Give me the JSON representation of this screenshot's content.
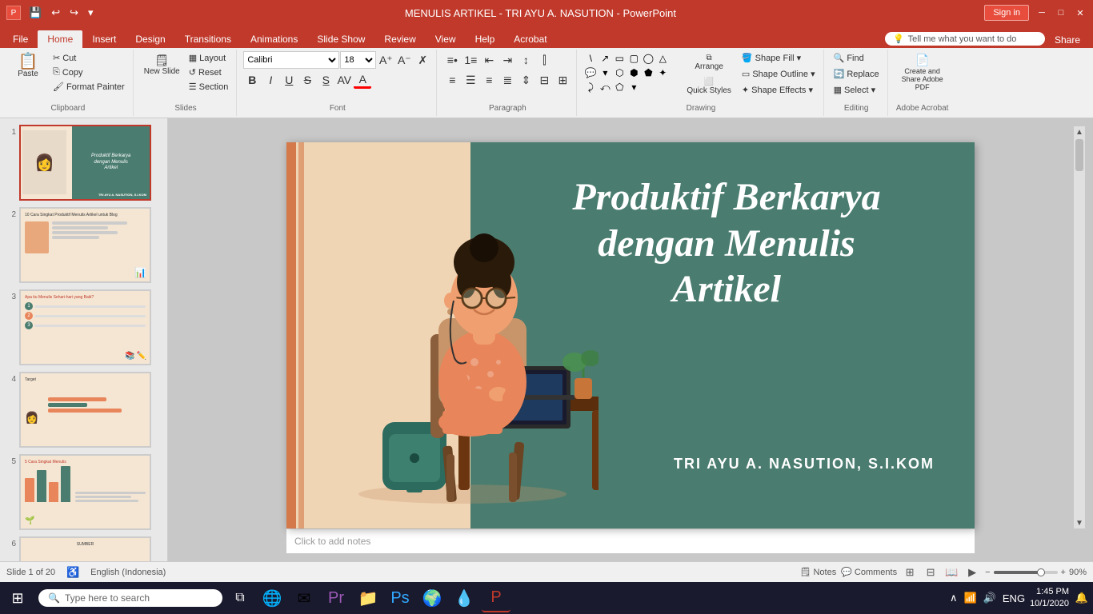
{
  "titlebar": {
    "title": "MENULIS ARTIKEL - TRI AYU A. NASUTION - PowerPoint",
    "sign_in": "Sign in"
  },
  "quickaccess": {
    "save": "💾",
    "undo": "↩",
    "redo": "↪",
    "customize": "▾"
  },
  "tabs": [
    {
      "label": "File",
      "active": false
    },
    {
      "label": "Home",
      "active": true
    },
    {
      "label": "Insert",
      "active": false
    },
    {
      "label": "Design",
      "active": false
    },
    {
      "label": "Transitions",
      "active": false
    },
    {
      "label": "Animations",
      "active": false
    },
    {
      "label": "Slide Show",
      "active": false
    },
    {
      "label": "Review",
      "active": false
    },
    {
      "label": "View",
      "active": false
    },
    {
      "label": "Help",
      "active": false
    },
    {
      "label": "Acrobat",
      "active": false
    }
  ],
  "tell_me": "Tell me what you want to do",
  "share": "Share",
  "ribbon": {
    "clipboard": {
      "label": "Clipboard",
      "paste": "Paste",
      "cut": "Cut",
      "copy": "Copy",
      "format_painter": "Format Painter"
    },
    "slides": {
      "label": "Slides",
      "new_slide": "New Slide",
      "layout": "Layout",
      "reset": "Reset",
      "section": "Section"
    },
    "font": {
      "label": "Font",
      "font_family": "Calibri",
      "font_size": "18",
      "bold": "B",
      "italic": "I",
      "underline": "U",
      "strikethrough": "S",
      "shadow": "S",
      "char_spacing": "A",
      "font_color": "A",
      "increase_font": "A↑",
      "decrease_font": "A↓",
      "clear_formatting": "✗A"
    },
    "paragraph": {
      "label": "Paragraph",
      "bullets": "≡",
      "numbering": "1≡",
      "decrease_indent": "←≡",
      "increase_indent": "→≡",
      "line_spacing": "↕≡",
      "align_left": "≡",
      "align_center": "≡",
      "align_right": "≡",
      "justify": "≡",
      "columns": "⫿"
    },
    "drawing": {
      "label": "Drawing",
      "arrange": "Arrange",
      "quick_styles": "Quick Styles",
      "shape_fill": "Shape Fill ▾",
      "shape_outline": "Shape Outline ▾",
      "shape_effects": "Shape Effects ▾"
    },
    "editing": {
      "label": "Editing",
      "find": "Find",
      "replace": "Replace",
      "select": "Select ▾"
    },
    "acrobat": {
      "label": "Adobe Acrobat",
      "create_share": "Create and Share Adobe PDF"
    }
  },
  "slides": [
    {
      "num": "1",
      "active": true
    },
    {
      "num": "2",
      "active": false
    },
    {
      "num": "3",
      "active": false
    },
    {
      "num": "4",
      "active": false
    },
    {
      "num": "5",
      "active": false
    },
    {
      "num": "6",
      "active": false
    }
  ],
  "main_slide": {
    "title_line1": "Produktif Berkarya",
    "title_line2": "dengan Menulis",
    "title_line3": "Artikel",
    "subtitle": "TRI AYU A. NASUTION, S.I.KOM",
    "notes_placeholder": "Click to add notes"
  },
  "statusbar": {
    "slide_info": "Slide 1 of 20",
    "language": "English (Indonesia)",
    "notes": "Notes",
    "comments": "Comments",
    "zoom": "90%"
  },
  "taskbar": {
    "search_placeholder": "Type here to search",
    "time": "1:45 PM",
    "date": "10/1/2020",
    "language": "ENG"
  },
  "apps": [
    {
      "icon": "🌐",
      "name": "chrome"
    },
    {
      "icon": "✉",
      "name": "mail"
    },
    {
      "icon": "🎬",
      "name": "premiere"
    },
    {
      "icon": "📁",
      "name": "files"
    },
    {
      "icon": "🖼",
      "name": "photoshop"
    },
    {
      "icon": "🌍",
      "name": "browser2"
    },
    {
      "icon": "💧",
      "name": "app7"
    },
    {
      "icon": "📊",
      "name": "powerpoint"
    }
  ]
}
